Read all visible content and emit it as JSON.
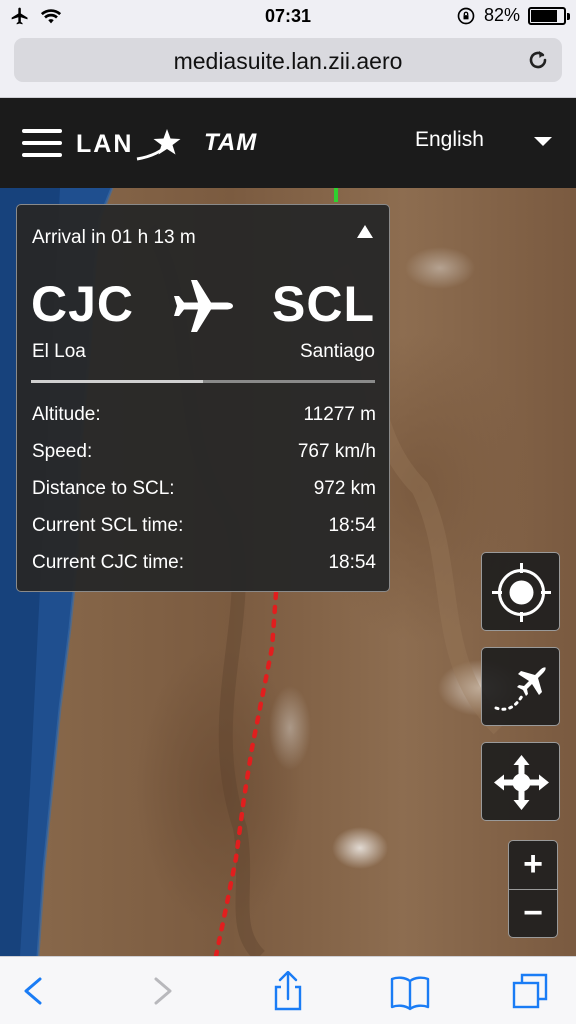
{
  "status_bar": {
    "time": "07:31",
    "battery_text": "82%",
    "battery_level": 0.82,
    "icons": [
      "airplane-icon",
      "wifi-icon",
      "orientation-lock-icon",
      "battery-icon"
    ]
  },
  "browser": {
    "url": "mediasuite.lan.zii.aero",
    "reload_icon": "reload-icon"
  },
  "header": {
    "menu_icon": "hamburger-icon",
    "brand_lan": "LAN",
    "brand_tam": "TAM",
    "language": "English"
  },
  "flight": {
    "arrival_text": "Arrival in 01 h 13 m",
    "origin_code": "CJC",
    "origin_city": "El Loa",
    "destination_code": "SCL",
    "destination_city": "Santiago",
    "progress_fraction": 0.5,
    "stats": [
      {
        "label": "Altitude:",
        "value": "11277 m"
      },
      {
        "label": "Speed:",
        "value": "767 km/h"
      },
      {
        "label": "Distance to SCL:",
        "value": "972 km"
      },
      {
        "label": "Current SCL time:",
        "value": "18:54"
      },
      {
        "label": "Current CJC time:",
        "value": "18:54"
      }
    ]
  },
  "map_controls": {
    "buttons": [
      "locate-icon",
      "flight-path-icon",
      "pan-arrows-icon"
    ],
    "zoom_in": "+",
    "zoom_out": "−"
  },
  "colors": {
    "header_bg": "#1b1b1b",
    "panel_bg": "#282828",
    "route_red": "#e11e1e",
    "route_green": "#2fd12f",
    "ios_blue": "#1a7cf5"
  }
}
